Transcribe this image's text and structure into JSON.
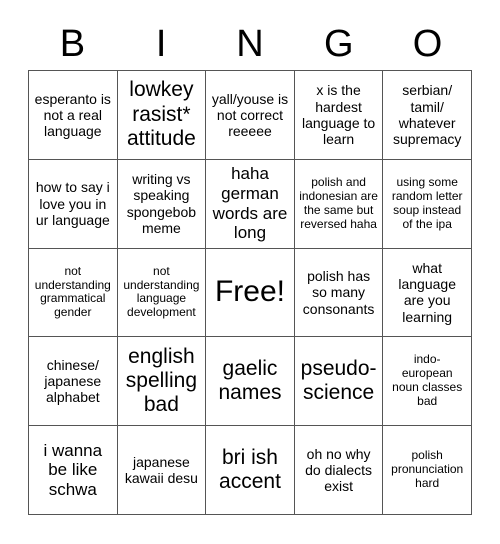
{
  "header": {
    "letters": [
      "B",
      "I",
      "N",
      "G",
      "O"
    ]
  },
  "grid": {
    "rows": 5,
    "columns": 5,
    "border_color": "#555555",
    "background_color": "#ffffff",
    "text_color": "#000000",
    "cells": [
      {
        "text": "esperanto is not a real language",
        "size": "fs-m"
      },
      {
        "text": "lowkey rasist* attitude",
        "size": "fs-xl"
      },
      {
        "text": "yall/youse is not correct reeeee",
        "size": "fs-m"
      },
      {
        "text": "x is the hardest language to learn",
        "size": "fs-m"
      },
      {
        "text": "serbian/ tamil/ whatever supremacy",
        "size": "fs-m"
      },
      {
        "text": "how to say i love you in ur language",
        "size": "fs-m"
      },
      {
        "text": "writing vs speaking spongebob meme",
        "size": "fs-m"
      },
      {
        "text": "haha german words are long",
        "size": "fs-l"
      },
      {
        "text": "polish and indonesian are the same but reversed haha",
        "size": "fs-s"
      },
      {
        "text": "using some random letter soup instead of the ipa",
        "size": "fs-s"
      },
      {
        "text": "not understanding grammatical gender",
        "size": "fs-s"
      },
      {
        "text": "not understanding language development",
        "size": "fs-s"
      },
      {
        "text": "Free!",
        "size": "fs-xxl"
      },
      {
        "text": "polish has so many consonants",
        "size": "fs-m"
      },
      {
        "text": "what language are you learning",
        "size": "fs-m"
      },
      {
        "text": "chinese/ japanese alphabet",
        "size": "fs-m"
      },
      {
        "text": "english spelling bad",
        "size": "fs-xl"
      },
      {
        "text": "gaelic names",
        "size": "fs-xl"
      },
      {
        "text": "pseudo- science",
        "size": "fs-xl"
      },
      {
        "text": "indo- european noun classes bad",
        "size": "fs-s"
      },
      {
        "text": "i wanna be like schwa",
        "size": "fs-l"
      },
      {
        "text": "japanese kawaii desu",
        "size": "fs-m"
      },
      {
        "text": "bri ish accent",
        "size": "fs-xl"
      },
      {
        "text": "oh no why do dialects exist",
        "size": "fs-m"
      },
      {
        "text": "polish pronunciation hard",
        "size": "fs-s"
      }
    ]
  }
}
